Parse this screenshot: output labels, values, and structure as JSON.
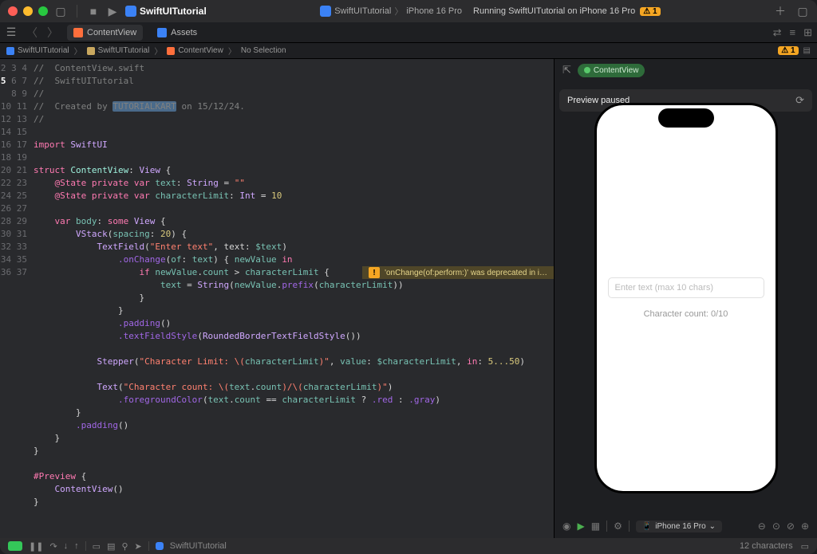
{
  "titlebar": {
    "project": "SwiftUITutorial",
    "scheme": "SwiftUITutorial",
    "device": "iPhone 16 Pro",
    "status": "Running SwiftUITutorial on iPhone 16 Pro",
    "warning_count": "1"
  },
  "tabs": {
    "file1": "ContentView",
    "file2": "Assets"
  },
  "breadcrumb": {
    "p1": "SwiftUITutorial",
    "p2": "SwiftUITutorial",
    "p3": "ContentView",
    "p4": "No Selection"
  },
  "editor": {
    "lines": [
      "2",
      "3",
      "4",
      "5",
      "6",
      "7",
      "8",
      "9",
      "10",
      "11",
      "12",
      "13",
      "14",
      "15",
      "16",
      "17",
      "18",
      "19",
      "20",
      "21",
      "22",
      "23",
      "24",
      "25",
      "26",
      "27",
      "28",
      "29",
      "30",
      "31",
      "32",
      "33",
      "34",
      "35",
      "36",
      "37"
    ],
    "warning_text": "'onChange(of:perform:)' was deprecated in i…",
    "c2": "//  ContentView.swift",
    "c3": "//  SwiftUITutorial",
    "c4": "//",
    "c5a": "//  Created by ",
    "c5b": "TUTORIALKART",
    "c5c": " on 15/12/24.",
    "c6": "//",
    "tk_import": "import",
    "tk_swiftui": "SwiftUI",
    "tk_struct": "struct",
    "tk_ContentView": "ContentView",
    "tk_view": "View",
    "tk_state": "@State",
    "tk_private": "private",
    "tk_var": "var",
    "tk_text": "text",
    "tk_String": "String",
    "tk_emptystr": "\"\"",
    "tk_characterLimit": "characterLimit",
    "tk_Int": "Int",
    "tk_ten": "10",
    "tk_body": "body",
    "tk_some": "some",
    "tk_VStack": "VStack",
    "tk_spacing": "spacing",
    "tk_twenty": "20",
    "tk_TextField": "TextField",
    "tk_enter": "\"Enter text\"",
    "tk_textarg": "$text",
    "tk_onChange": ".onChange",
    "tk_of": "of",
    "tk_newValue": "newValue",
    "tk_in": "in",
    "tk_if": "if",
    "tk_count": "count",
    "tk_String2": "String",
    "tk_prefix": "prefix",
    "tk_padding": ".padding",
    "tk_tfs": ".textFieldStyle",
    "tk_rbtfs": "RoundedBorderTextFieldStyle",
    "tk_Stepper": "Stepper",
    "tk_stepper_str": "\"Character Limit: \\(",
    "tk_stepper_str2": ")\"",
    "tk_value": "value",
    "tk_binding": "$characterLimit",
    "tk_range": "5...50",
    "tk_Text": "Text",
    "tk_countstr": "\"Character count: \\(",
    "tk_countmid": ")/\\(",
    "tk_countend": ")\"",
    "tk_fgc": ".foregroundColor",
    "tk_eq": "==",
    "tk_q": "?",
    "tk_red": ".red",
    "tk_colon2": ":",
    "tk_gray": ".gray",
    "tk_Preview": "#Preview"
  },
  "preview": {
    "badge": "ContentView",
    "paused": "Preview paused",
    "placeholder": "Enter text (max 10 chars)",
    "charcount": "Character count: 0/10",
    "device": "iPhone 16 Pro"
  },
  "bottom": {
    "project": "SwiftUITutorial",
    "chars": "12 characters"
  }
}
